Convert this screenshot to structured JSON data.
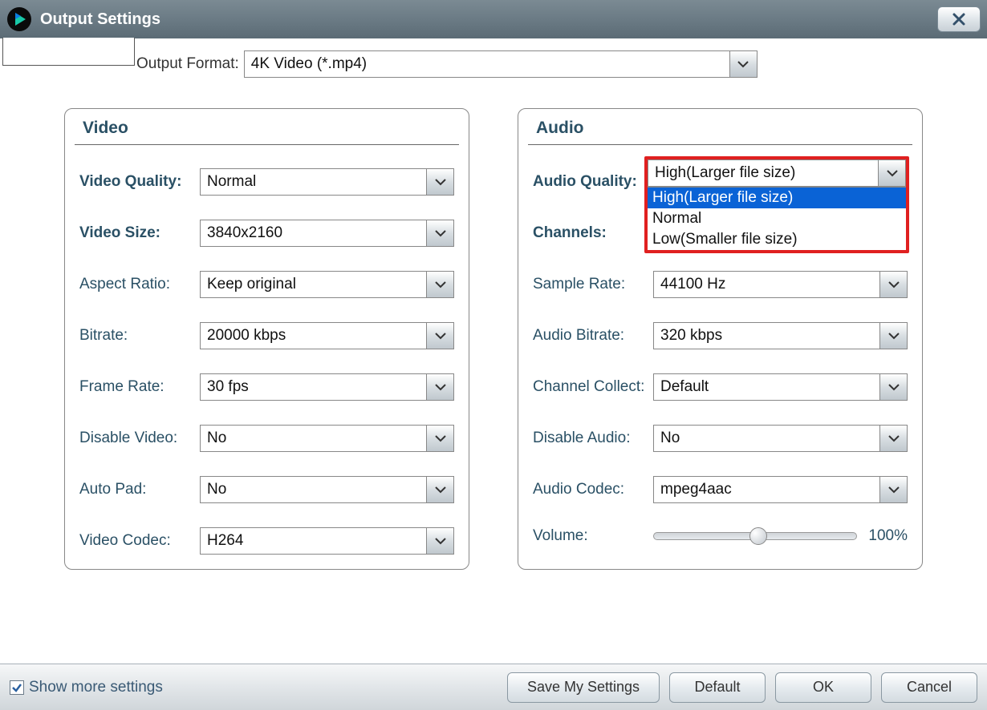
{
  "titlebar": {
    "title": "Output Settings"
  },
  "output_format": {
    "label": "Output Format:",
    "value": "4K Video (*.mp4)"
  },
  "video": {
    "title": "Video",
    "quality": {
      "label": "Video Quality:",
      "value": "Normal"
    },
    "size": {
      "label": "Video Size:",
      "value": "3840x2160"
    },
    "aspect": {
      "label": "Aspect Ratio:",
      "value": "Keep original"
    },
    "bitrate": {
      "label": "Bitrate:",
      "value": "20000 kbps"
    },
    "fps": {
      "label": "Frame Rate:",
      "value": "30 fps"
    },
    "disable": {
      "label": "Disable Video:",
      "value": "No"
    },
    "autopad": {
      "label": "Auto Pad:",
      "value": "No"
    },
    "codec": {
      "label": "Video Codec:",
      "value": "H264"
    }
  },
  "audio": {
    "title": "Audio",
    "quality": {
      "label": "Audio Quality:",
      "value": "High(Larger file size)",
      "options": [
        "High(Larger file size)",
        "Normal",
        "Low(Smaller file size)"
      ]
    },
    "channels": {
      "label": "Channels:"
    },
    "sample": {
      "label": "Sample Rate:",
      "value": "44100 Hz"
    },
    "bitrate": {
      "label": "Audio Bitrate:",
      "value": "320 kbps"
    },
    "collect": {
      "label": "Channel Collect:",
      "value": "Default"
    },
    "disable": {
      "label": "Disable Audio:",
      "value": "No"
    },
    "codec": {
      "label": "Audio Codec:",
      "value": "mpeg4aac"
    },
    "volume": {
      "label": "Volume:",
      "value": "100%"
    }
  },
  "footer": {
    "show_more": "Show more settings",
    "save": "Save My Settings",
    "default": "Default",
    "ok": "OK",
    "cancel": "Cancel"
  }
}
